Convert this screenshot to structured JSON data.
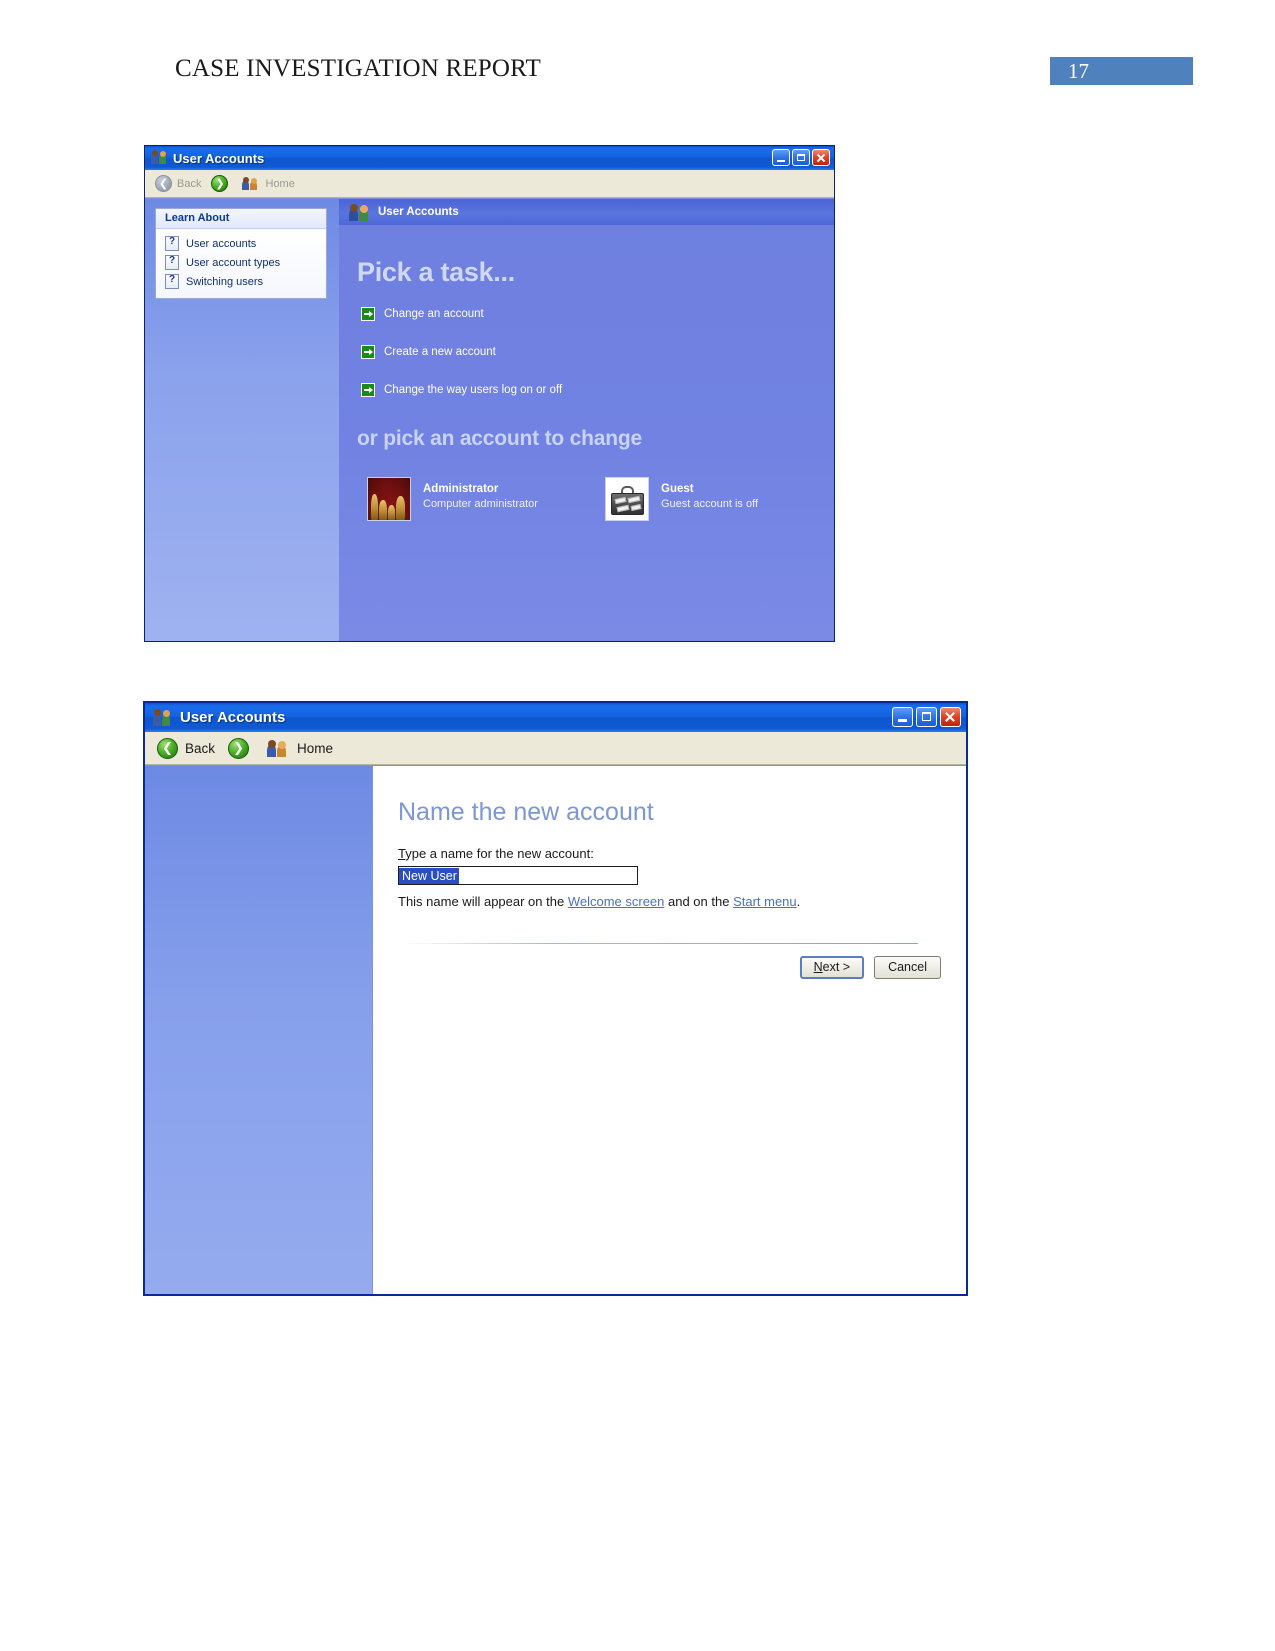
{
  "document": {
    "title": "CASE INVESTIGATION REPORT",
    "page_number": "17",
    "badge_color": "#4f81bd"
  },
  "window_one": {
    "titlebar": {
      "title": "User Accounts",
      "icon": "user-accounts-icon",
      "minimize_label": "Minimize",
      "maximize_label": "Maximize",
      "close_label": "Close"
    },
    "navbar": {
      "back_label": "Back",
      "forward_label": "Forward",
      "home_label": "Home"
    },
    "sidebar": {
      "panel_title": "Learn About",
      "items": [
        {
          "label": "User accounts",
          "icon": "help-icon"
        },
        {
          "label": "User account types",
          "icon": "help-icon"
        },
        {
          "label": "Switching users",
          "icon": "help-icon"
        }
      ]
    },
    "main": {
      "header_title": "User Accounts",
      "pick_task_heading": "Pick a task...",
      "tasks": [
        {
          "label": "Change an account",
          "icon": "green-arrow-icon"
        },
        {
          "label": "Create a new account",
          "icon": "green-arrow-icon"
        },
        {
          "label": "Change the way users log on or off",
          "icon": "green-arrow-icon"
        }
      ],
      "pick_account_heading": "or pick an account to change",
      "accounts": [
        {
          "name": "Administrator",
          "description": "Computer administrator",
          "picture": "chess-pieces-picture"
        },
        {
          "name": "Guest",
          "description": "Guest account is off",
          "picture": "briefcase-picture"
        }
      ]
    }
  },
  "window_two": {
    "titlebar": {
      "title": "User Accounts",
      "icon": "user-accounts-icon",
      "minimize_label": "Minimize",
      "maximize_label": "Maximize",
      "close_label": "Close"
    },
    "navbar": {
      "back_label": "Back",
      "forward_label": "Forward",
      "home_label": "Home"
    },
    "main": {
      "heading": "Name the new account",
      "field_label_accesskey": "T",
      "field_label_rest": "ype a name for the new account:",
      "account_name_value": "New User",
      "account_name_placeholder": "New User",
      "note_prefix": "This name will appear on the ",
      "note_link_one": "Welcome screen",
      "note_middle": " and on the ",
      "note_link_two": "Start menu",
      "note_suffix": ".",
      "buttons": {
        "next_accesskey": "N",
        "next_rest": "ext >",
        "cancel_label": "Cancel"
      }
    }
  }
}
